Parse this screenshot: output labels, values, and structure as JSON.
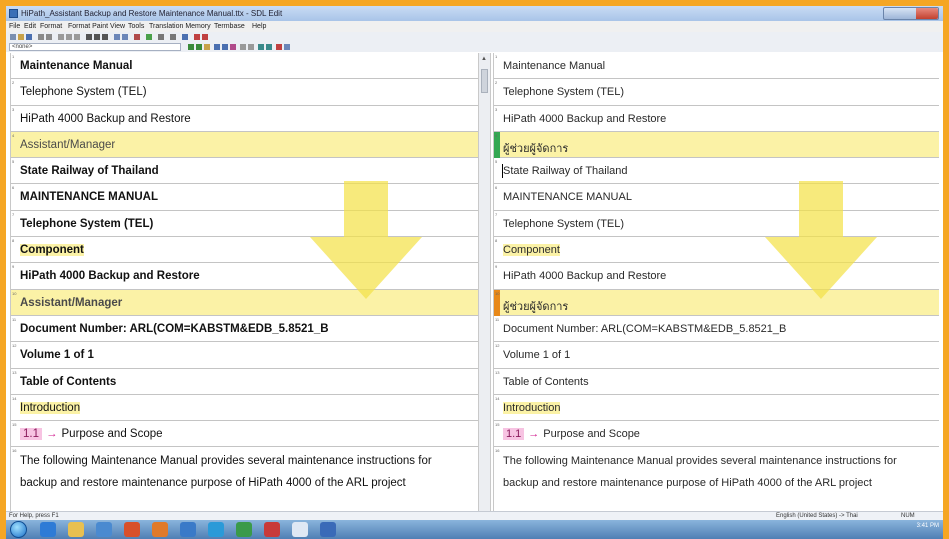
{
  "window": {
    "title": "HiPath_Assistant Backup and Restore Maintenance Manual.ttx - SDL Edit"
  },
  "menu": [
    "File",
    "Edit",
    "Format",
    "Format Paint",
    "View",
    "Tools",
    "Translation Memory",
    "Termbase",
    "Help"
  ],
  "toolbar": {
    "style_box": "<none>"
  },
  "source_segments": [
    {
      "num": "1",
      "text": "Maintenance Manual"
    },
    {
      "num": "2",
      "text": "Telephone System (TEL)"
    },
    {
      "num": "3",
      "text": "HiPath 4000 Backup and Restore"
    },
    {
      "num": "4",
      "text": "Assistant/Manager"
    },
    {
      "num": "5",
      "text": "State Railway of Thailand"
    },
    {
      "num": "6",
      "text": "MAINTENANCE MANUAL"
    },
    {
      "num": "7",
      "text": "Telephone System (TEL)"
    },
    {
      "num": "8",
      "text": "Component"
    },
    {
      "num": "9",
      "text": "HiPath 4000 Backup and Restore"
    },
    {
      "num": "10",
      "text": "Assistant/Manager"
    },
    {
      "num": "11",
      "text": "Document Number: ARL(COM=KABSTM&EDB_5.8521_B"
    },
    {
      "num": "12",
      "text": "Volume 1 of 1"
    },
    {
      "num": "13",
      "text": "Table of Contents"
    },
    {
      "num": "14",
      "text": "Introduction"
    },
    {
      "num": "15",
      "tag": "1.1",
      "text": "Purpose and Scope"
    },
    {
      "num": "16",
      "text": "The following Maintenance Manual provides several maintenance instructions for backup and restore maintenance purpose of HiPath 4000 of the ARL project"
    }
  ],
  "target_segments": [
    {
      "num": "1",
      "text": "Maintenance Manual"
    },
    {
      "num": "2",
      "text": "Telephone System (TEL)"
    },
    {
      "num": "3",
      "text": "HiPath 4000 Backup and Restore"
    },
    {
      "num": "4",
      "text": "ผู้ช่วยผู้จัดการ"
    },
    {
      "num": "5",
      "text": "State Railway of Thailand"
    },
    {
      "num": "6",
      "text": "MAINTENANCE MANUAL"
    },
    {
      "num": "7",
      "text": "Telephone System (TEL)"
    },
    {
      "num": "8",
      "text": "Component"
    },
    {
      "num": "9",
      "text": "HiPath 4000 Backup and Restore"
    },
    {
      "num": "10",
      "text": "ผู้ช่วยผู้จัดการ"
    },
    {
      "num": "11",
      "text": "Document Number: ARL(COM=KABSTM&EDB_5.8521_B"
    },
    {
      "num": "12",
      "text": "Volume 1 of 1"
    },
    {
      "num": "13",
      "text": "Table of Contents"
    },
    {
      "num": "14",
      "text": "Introduction"
    },
    {
      "num": "15",
      "tag": "1.1",
      "text": "Purpose and Scope"
    },
    {
      "num": "16",
      "text": "The following Maintenance Manual provides several maintenance instructions for backup and restore maintenance purpose of HiPath 4000 of the ARL project"
    }
  ],
  "status": {
    "help": "For Help, press F1",
    "language_pair": "English (United States) -> Thai",
    "mode": "NUM"
  },
  "taskbar": {
    "time": "3:41 PM"
  },
  "colors": {
    "highlight": "#fbf2a6",
    "arrow": "#f4e24a",
    "frame": "#f5a623",
    "mark_green": "#34a853",
    "mark_orange": "#e8891a"
  }
}
